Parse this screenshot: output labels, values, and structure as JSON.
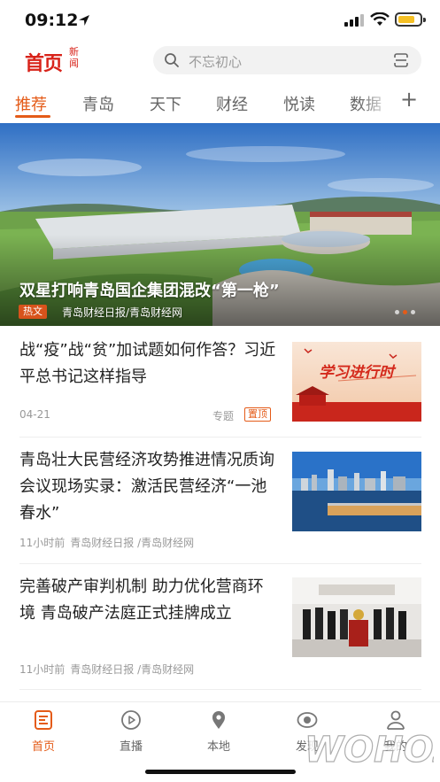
{
  "status_bar": {
    "time": "09:12"
  },
  "header": {
    "logo_main": "首页",
    "logo_sub": "新闻",
    "search_placeholder": "不忘初心"
  },
  "tabs": [
    {
      "label": "推荐",
      "active": true
    },
    {
      "label": "青岛"
    },
    {
      "label": "天下"
    },
    {
      "label": "财经"
    },
    {
      "label": "悦读"
    },
    {
      "label": "数据"
    }
  ],
  "tab_more": "+",
  "hero": {
    "title": "双星打响青岛国企集团混改“第一枪”",
    "tag": "热文",
    "source": "青岛财经日报/青岛财经网",
    "slide_count": 3,
    "active_slide": 2
  },
  "news": [
    {
      "title": "战“疫”战“贫”加试题如何作答？习近平总书记这样指导",
      "date": "04-21",
      "topic": "专题",
      "badge": "置顶",
      "thumb_caption": "学习进行时"
    },
    {
      "title": "青岛壮大民营经济攻势推进情况质询会议现场实录：激活民营经济“一池春水”",
      "time": "11小时前",
      "source": "青岛财经日报 /青岛财经网"
    },
    {
      "title": "完善破产审判机制 助力优化营商环境  青岛破产法庭正式挂牌成立",
      "time": "11小时前",
      "source": "青岛财经日报 /青岛财经网"
    }
  ],
  "bottom_nav": [
    {
      "label": "首页",
      "icon": "home-doc-icon",
      "active": true
    },
    {
      "label": "直播",
      "icon": "play-circle-icon"
    },
    {
      "label": "本地",
      "icon": "location-pin-icon"
    },
    {
      "label": "发现",
      "icon": "eye-discover-icon"
    },
    {
      "label": "我的",
      "icon": "user-icon"
    }
  ],
  "watermark": "WOHOZ",
  "colors": {
    "accent": "#e45b18",
    "brand_red": "#d8231a"
  }
}
